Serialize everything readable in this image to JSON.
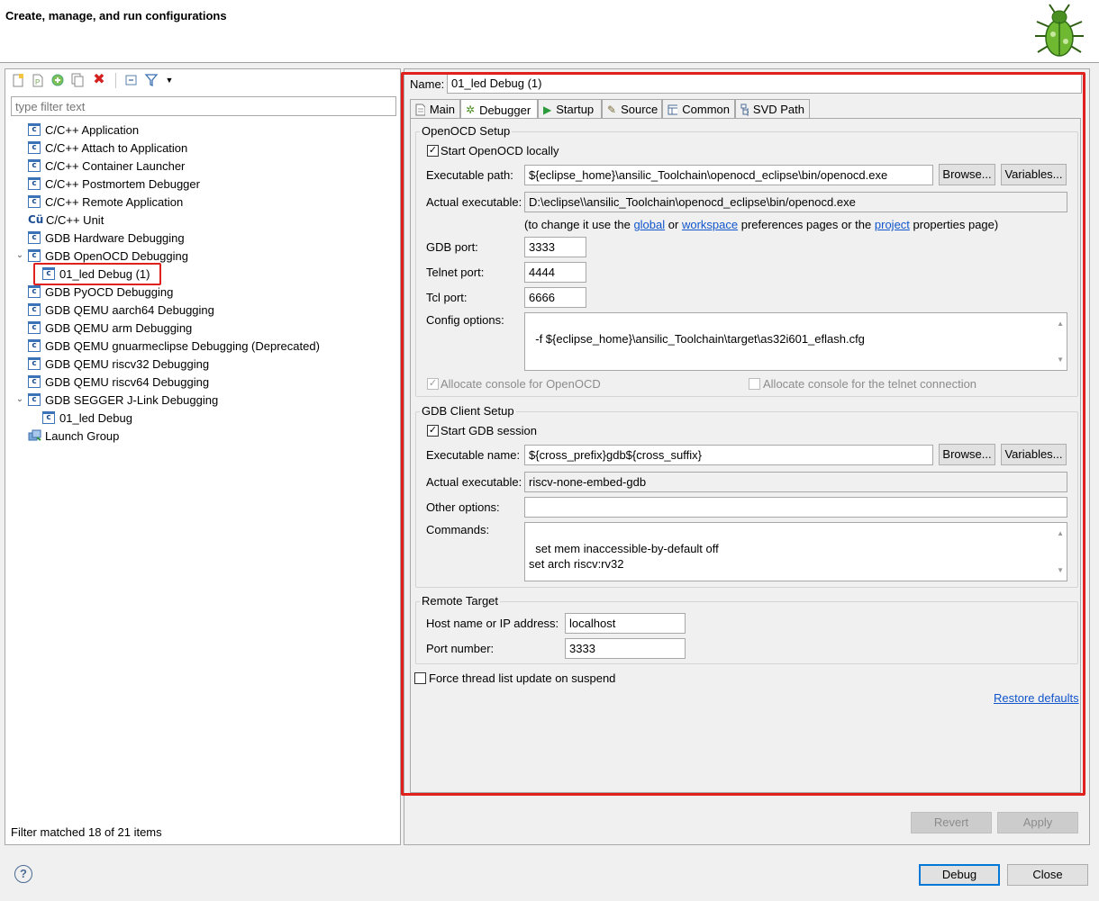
{
  "header": {
    "title": "Create, manage, and run configurations",
    "logo_icon": "bug-icon"
  },
  "left": {
    "filter_placeholder": "type filter text",
    "tree": [
      "C/C++ Application",
      "C/C++ Attach to Application",
      "C/C++ Container Launcher",
      "C/C++ Postmortem Debugger",
      "C/C++ Remote Application",
      "C/C++ Unit",
      "GDB Hardware Debugging",
      "GDB OpenOCD Debugging",
      "01_led Debug (1)",
      "GDB PyOCD Debugging",
      "GDB QEMU aarch64 Debugging",
      "GDB QEMU arm Debugging",
      "GDB QEMU gnuarmeclipse Debugging (Deprecated)",
      "GDB QEMU riscv32 Debugging",
      "GDB QEMU riscv64 Debugging",
      "GDB SEGGER J-Link Debugging",
      "01_led Debug",
      "Launch Group"
    ],
    "filter_status": "Filter matched 18 of 21 items"
  },
  "right": {
    "name_label": "Name:",
    "name_value": "01_led Debug (1)",
    "tabs": [
      "Main",
      "Debugger",
      "Startup",
      "Source",
      "Common",
      "SVD Path"
    ],
    "openocd": {
      "title": "OpenOCD Setup",
      "start_locally": "Start OpenOCD locally",
      "exec_path_label": "Executable path:",
      "exec_path_value": "${eclipse_home}\\ansilic_Toolchain\\openocd_eclipse\\bin/openocd.exe",
      "actual_exec_label": "Actual executable:",
      "actual_exec_value": "D:\\eclipse\\\\ansilic_Toolchain\\openocd_eclipse\\bin/openocd.exe",
      "hint_prefix": "(to change it use the",
      "hint_global": "global",
      "hint_or": "or",
      "hint_workspace": "workspace",
      "hint_middle": "preferences pages or the",
      "hint_project": "project",
      "hint_suffix": "properties page)",
      "gdb_port_label": "GDB port:",
      "gdb_port_value": "3333",
      "telnet_port_label": "Telnet port:",
      "telnet_port_value": "4444",
      "tcl_port_label": "Tcl port:",
      "tcl_port_value": "6666",
      "config_label": "Config options:",
      "config_value": "-f ${eclipse_home}\\ansilic_Toolchain\\target\\as32i601_eflash.cfg",
      "alloc_console": "Allocate console for OpenOCD",
      "alloc_telnet": "Allocate console for the telnet connection"
    },
    "gdb": {
      "title": "GDB Client Setup",
      "start_session": "Start GDB session",
      "exec_name_label": "Executable name:",
      "exec_name_value": "${cross_prefix}gdb${cross_suffix}",
      "actual_exec_label": "Actual executable:",
      "actual_exec_value": "riscv-none-embed-gdb",
      "other_options_label": "Other options:",
      "other_options_value": "",
      "commands_label": "Commands:",
      "commands_value": "set mem inaccessible-by-default off\nset arch riscv:rv32"
    },
    "remote": {
      "title": "Remote Target",
      "host_label": "Host name or IP address:",
      "host_value": "localhost",
      "port_label": "Port number:",
      "port_value": "3333"
    },
    "force_thread": "Force thread list update on suspend",
    "restore_defaults": "Restore defaults",
    "browse": "Browse...",
    "variables": "Variables...",
    "revert": "Revert",
    "apply": "Apply"
  },
  "footer": {
    "debug": "Debug",
    "close": "Close",
    "help_icon": "?"
  },
  "colors": {
    "highlight": "#e0201c",
    "link": "#1155cc",
    "default_button": "#0078d7"
  }
}
